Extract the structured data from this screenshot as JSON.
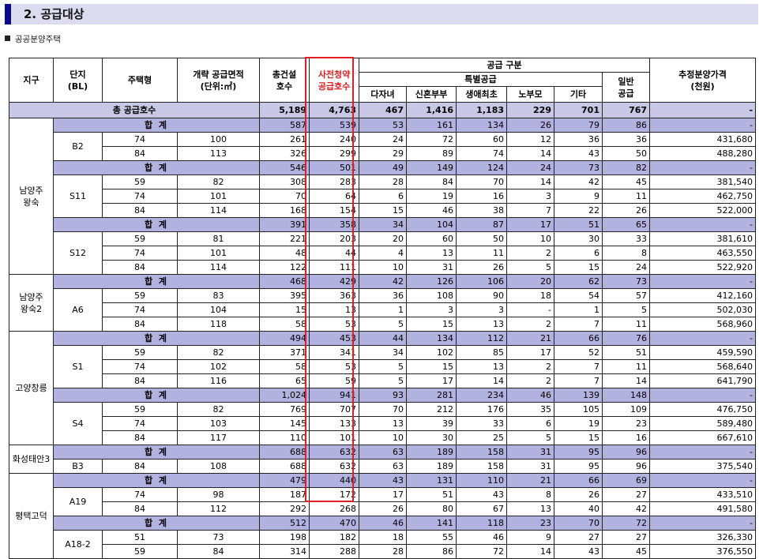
{
  "section": {
    "number_title": "2. 공급대상",
    "sub": "공공분양주택"
  },
  "headers": {
    "district": "지구",
    "block_l1": "단지",
    "block_l2": "(BL)",
    "type": "주택형",
    "area_l1": "개략 공급면적",
    "area_l2": "(단위:㎡)",
    "total_l1": "총건설",
    "total_l2": "호수",
    "pre_l1": "사전청약",
    "pre_l2": "공급호수",
    "supply_type": "공급 구분",
    "special": "특별공급",
    "multi_child": "다자녀",
    "newlywed": "신혼부부",
    "first_time": "생애최초",
    "elderly": "노부모",
    "other": "기타",
    "general_l1": "일반",
    "general_l2": "공급",
    "price_l1": "추정분양가격",
    "price_l2": "(천원)"
  },
  "grand_total": {
    "label": "총 공급호수",
    "values": [
      "5,189",
      "4,763",
      "467",
      "1,416",
      "1,183",
      "229",
      "701",
      "767",
      "-"
    ]
  },
  "sum_label": "합 계",
  "rows": [
    {
      "kind": "sub",
      "values": [
        "587",
        "539",
        "53",
        "161",
        "134",
        "26",
        "79",
        "86",
        "-"
      ]
    },
    {
      "kind": "data",
      "type": "74",
      "area": "100",
      "values": [
        "261",
        "240",
        "24",
        "72",
        "60",
        "12",
        "36",
        "36",
        "431,680"
      ]
    },
    {
      "kind": "data",
      "type": "84",
      "area": "113",
      "values": [
        "326",
        "299",
        "29",
        "89",
        "74",
        "14",
        "43",
        "50",
        "488,280"
      ]
    },
    {
      "kind": "sub",
      "values": [
        "546",
        "501",
        "49",
        "149",
        "124",
        "24",
        "73",
        "82",
        "-"
      ]
    },
    {
      "kind": "data",
      "type": "59",
      "area": "82",
      "values": [
        "308",
        "283",
        "28",
        "84",
        "70",
        "14",
        "42",
        "45",
        "381,540"
      ]
    },
    {
      "kind": "data",
      "type": "74",
      "area": "101",
      "values": [
        "70",
        "64",
        "6",
        "19",
        "16",
        "3",
        "9",
        "11",
        "462,750"
      ]
    },
    {
      "kind": "data",
      "type": "84",
      "area": "114",
      "values": [
        "168",
        "154",
        "15",
        "46",
        "38",
        "7",
        "22",
        "26",
        "522,000"
      ]
    },
    {
      "kind": "sub",
      "values": [
        "391",
        "358",
        "34",
        "104",
        "87",
        "17",
        "51",
        "65",
        "-"
      ]
    },
    {
      "kind": "data",
      "type": "59",
      "area": "81",
      "values": [
        "221",
        "203",
        "20",
        "60",
        "50",
        "10",
        "30",
        "33",
        "381,610"
      ]
    },
    {
      "kind": "data",
      "type": "74",
      "area": "101",
      "values": [
        "48",
        "44",
        "4",
        "13",
        "11",
        "2",
        "6",
        "8",
        "463,550"
      ]
    },
    {
      "kind": "data",
      "type": "84",
      "area": "114",
      "values": [
        "122",
        "111",
        "10",
        "31",
        "26",
        "5",
        "15",
        "24",
        "522,920"
      ]
    },
    {
      "kind": "sub",
      "values": [
        "468",
        "429",
        "42",
        "126",
        "106",
        "20",
        "62",
        "73",
        "-"
      ]
    },
    {
      "kind": "data",
      "type": "59",
      "area": "83",
      "values": [
        "395",
        "363",
        "36",
        "108",
        "90",
        "18",
        "54",
        "57",
        "412,160"
      ]
    },
    {
      "kind": "data",
      "type": "74",
      "area": "104",
      "values": [
        "15",
        "13",
        "1",
        "3",
        "3",
        "-",
        "1",
        "5",
        "502,030"
      ]
    },
    {
      "kind": "data",
      "type": "84",
      "area": "118",
      "values": [
        "58",
        "53",
        "5",
        "15",
        "13",
        "2",
        "7",
        "11",
        "568,960"
      ]
    },
    {
      "kind": "sub",
      "values": [
        "494",
        "453",
        "44",
        "134",
        "112",
        "21",
        "66",
        "76",
        "-"
      ]
    },
    {
      "kind": "data",
      "type": "59",
      "area": "82",
      "values": [
        "371",
        "341",
        "34",
        "102",
        "85",
        "17",
        "52",
        "51",
        "459,590"
      ]
    },
    {
      "kind": "data",
      "type": "74",
      "area": "102",
      "values": [
        "58",
        "53",
        "5",
        "15",
        "13",
        "2",
        "7",
        "11",
        "568,640"
      ]
    },
    {
      "kind": "data",
      "type": "84",
      "area": "116",
      "values": [
        "65",
        "59",
        "5",
        "17",
        "14",
        "2",
        "7",
        "14",
        "641,790"
      ]
    },
    {
      "kind": "sub",
      "values": [
        "1,024",
        "941",
        "93",
        "281",
        "234",
        "46",
        "139",
        "148",
        "-"
      ]
    },
    {
      "kind": "data",
      "type": "59",
      "area": "82",
      "values": [
        "769",
        "707",
        "70",
        "212",
        "176",
        "35",
        "105",
        "109",
        "476,750"
      ]
    },
    {
      "kind": "data",
      "type": "74",
      "area": "103",
      "values": [
        "145",
        "133",
        "13",
        "39",
        "33",
        "6",
        "19",
        "23",
        "589,480"
      ]
    },
    {
      "kind": "data",
      "type": "84",
      "area": "117",
      "values": [
        "110",
        "101",
        "10",
        "30",
        "25",
        "5",
        "15",
        "16",
        "667,610"
      ]
    },
    {
      "kind": "sub",
      "values": [
        "688",
        "632",
        "63",
        "189",
        "158",
        "31",
        "95",
        "96",
        "-"
      ]
    },
    {
      "kind": "data",
      "type": "84",
      "area": "108",
      "values": [
        "688",
        "632",
        "63",
        "189",
        "158",
        "31",
        "95",
        "96",
        "375,540"
      ]
    },
    {
      "kind": "sub",
      "values": [
        "479",
        "440",
        "43",
        "131",
        "110",
        "21",
        "66",
        "69",
        "-"
      ]
    },
    {
      "kind": "data",
      "type": "74",
      "area": "98",
      "values": [
        "187",
        "172",
        "17",
        "51",
        "43",
        "8",
        "26",
        "27",
        "433,510"
      ]
    },
    {
      "kind": "data",
      "type": "84",
      "area": "112",
      "values": [
        "292",
        "268",
        "26",
        "80",
        "67",
        "13",
        "40",
        "42",
        "491,580"
      ]
    },
    {
      "kind": "sub",
      "values": [
        "512",
        "470",
        "46",
        "141",
        "118",
        "23",
        "70",
        "72",
        "-"
      ]
    },
    {
      "kind": "data",
      "type": "51",
      "area": "73",
      "values": [
        "198",
        "182",
        "18",
        "55",
        "46",
        "9",
        "27",
        "27",
        "326,330"
      ]
    },
    {
      "kind": "data",
      "type": "59",
      "area": "84",
      "values": [
        "314",
        "288",
        "28",
        "86",
        "72",
        "14",
        "43",
        "45",
        "376,550"
      ]
    }
  ],
  "districts": [
    {
      "name": "남양주\n왕숙",
      "start": 0,
      "span": 11
    },
    {
      "name": "남양주\n왕숙2",
      "start": 11,
      "span": 4
    },
    {
      "name": "고양창릉",
      "start": 15,
      "span": 8
    },
    {
      "name": "화성태안3",
      "start": 23,
      "span": 2
    },
    {
      "name": "평택고덕",
      "start": 25,
      "span": 6
    }
  ],
  "blocks": [
    {
      "name": "B2",
      "start": 1,
      "span": 2
    },
    {
      "name": "S11",
      "start": 4,
      "span": 3
    },
    {
      "name": "S12",
      "start": 8,
      "span": 3
    },
    {
      "name": "A6",
      "start": 12,
      "span": 3
    },
    {
      "name": "S1",
      "start": 16,
      "span": 3
    },
    {
      "name": "S4",
      "start": 20,
      "span": 3
    },
    {
      "name": "B3",
      "start": 24,
      "span": 1
    },
    {
      "name": "A19",
      "start": 26,
      "span": 2
    },
    {
      "name": "A18-2",
      "start": 29,
      "span": 2
    }
  ]
}
